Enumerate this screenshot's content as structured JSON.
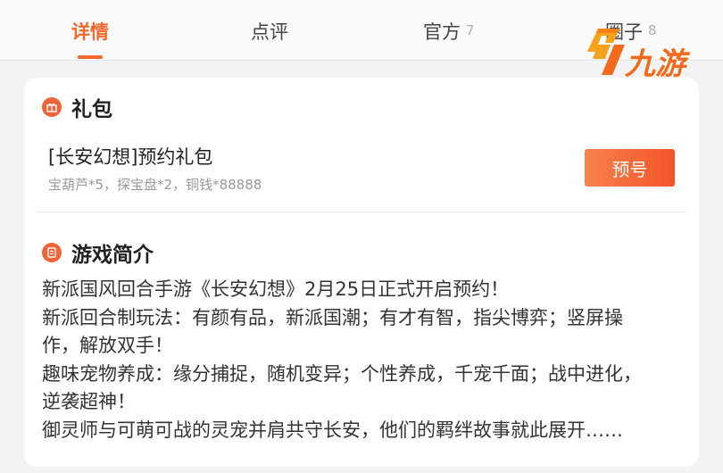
{
  "tabs": [
    {
      "label": "详情",
      "count": ""
    },
    {
      "label": "点评",
      "count": ""
    },
    {
      "label": "官方",
      "count": "7"
    },
    {
      "label": "圈子",
      "count": "8"
    }
  ],
  "logo": {
    "text": "九游",
    "icon": "jiuyou-logo-icon",
    "color": "#f26a1b"
  },
  "gift": {
    "section_title": "礼包",
    "name": "[长安幻想]预约礼包",
    "desc": "宝葫芦*5，探宝盘*2，铜钱*88888",
    "button_label": "预号"
  },
  "intro": {
    "section_title": "游戏简介",
    "lines": [
      "新派国风回合手游《长安幻想》2月25日正式开启预约！",
      "新派回合制玩法：有颜有品，新派国潮；有才有智，指尖博弈；竖屏操",
      "作，解放双手！",
      "趣味宠物养成：缘分捕捉，随机变异；个性养成，千宠千面；战中进化，",
      "逆袭超神！",
      "御灵师与可萌可战的灵宠并肩共守长安，他们的羁绊故事就此展开……"
    ]
  },
  "colors": {
    "accent": "#f46a2e",
    "button": "#f2552a"
  }
}
